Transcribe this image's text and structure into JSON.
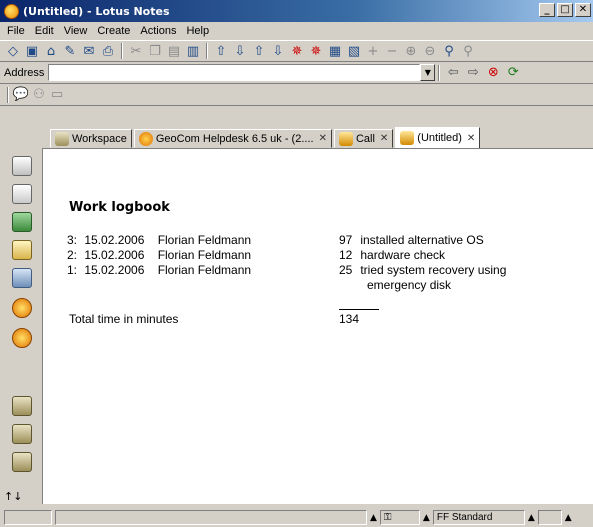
{
  "window": {
    "title": "(Untitled) - Lotus Notes",
    "minimize": "_",
    "maximize": "□",
    "close": "✕"
  },
  "menu": [
    "File",
    "Edit",
    "View",
    "Create",
    "Actions",
    "Help"
  ],
  "address": {
    "label": "Address",
    "value": ""
  },
  "tabs": [
    {
      "label": "Workspace",
      "icon": "workspace-icon"
    },
    {
      "label": "GeoCom Helpdesk 6.5 uk - (2....",
      "icon": "geocom-icon"
    },
    {
      "label": "Call",
      "icon": "call-icon"
    },
    {
      "label": "(Untitled)",
      "icon": "document-icon",
      "active": true
    }
  ],
  "document": {
    "heading": "Work logbook",
    "entries": [
      {
        "index": "3:",
        "date": "15.02.2006",
        "name": "Florian Feldmann",
        "minutes": "97",
        "text": "installed alternative OS",
        "continuation": ""
      },
      {
        "index": "2:",
        "date": "15.02.2006",
        "name": "Florian Feldmann",
        "minutes": "12",
        "text": "hardware check",
        "continuation": ""
      },
      {
        "index": "1:",
        "date": "15.02.2006",
        "name": "Florian Feldmann",
        "minutes": "25",
        "text": "tried system recovery using",
        "continuation": "emergency disk"
      }
    ],
    "total_label": "Total time in minutes",
    "total_value": "134"
  },
  "status": {
    "font": "FF Standard"
  },
  "colors": {
    "title_start": "#0a246a",
    "title_end": "#a6caf0",
    "chrome": "#d4d0c8"
  }
}
